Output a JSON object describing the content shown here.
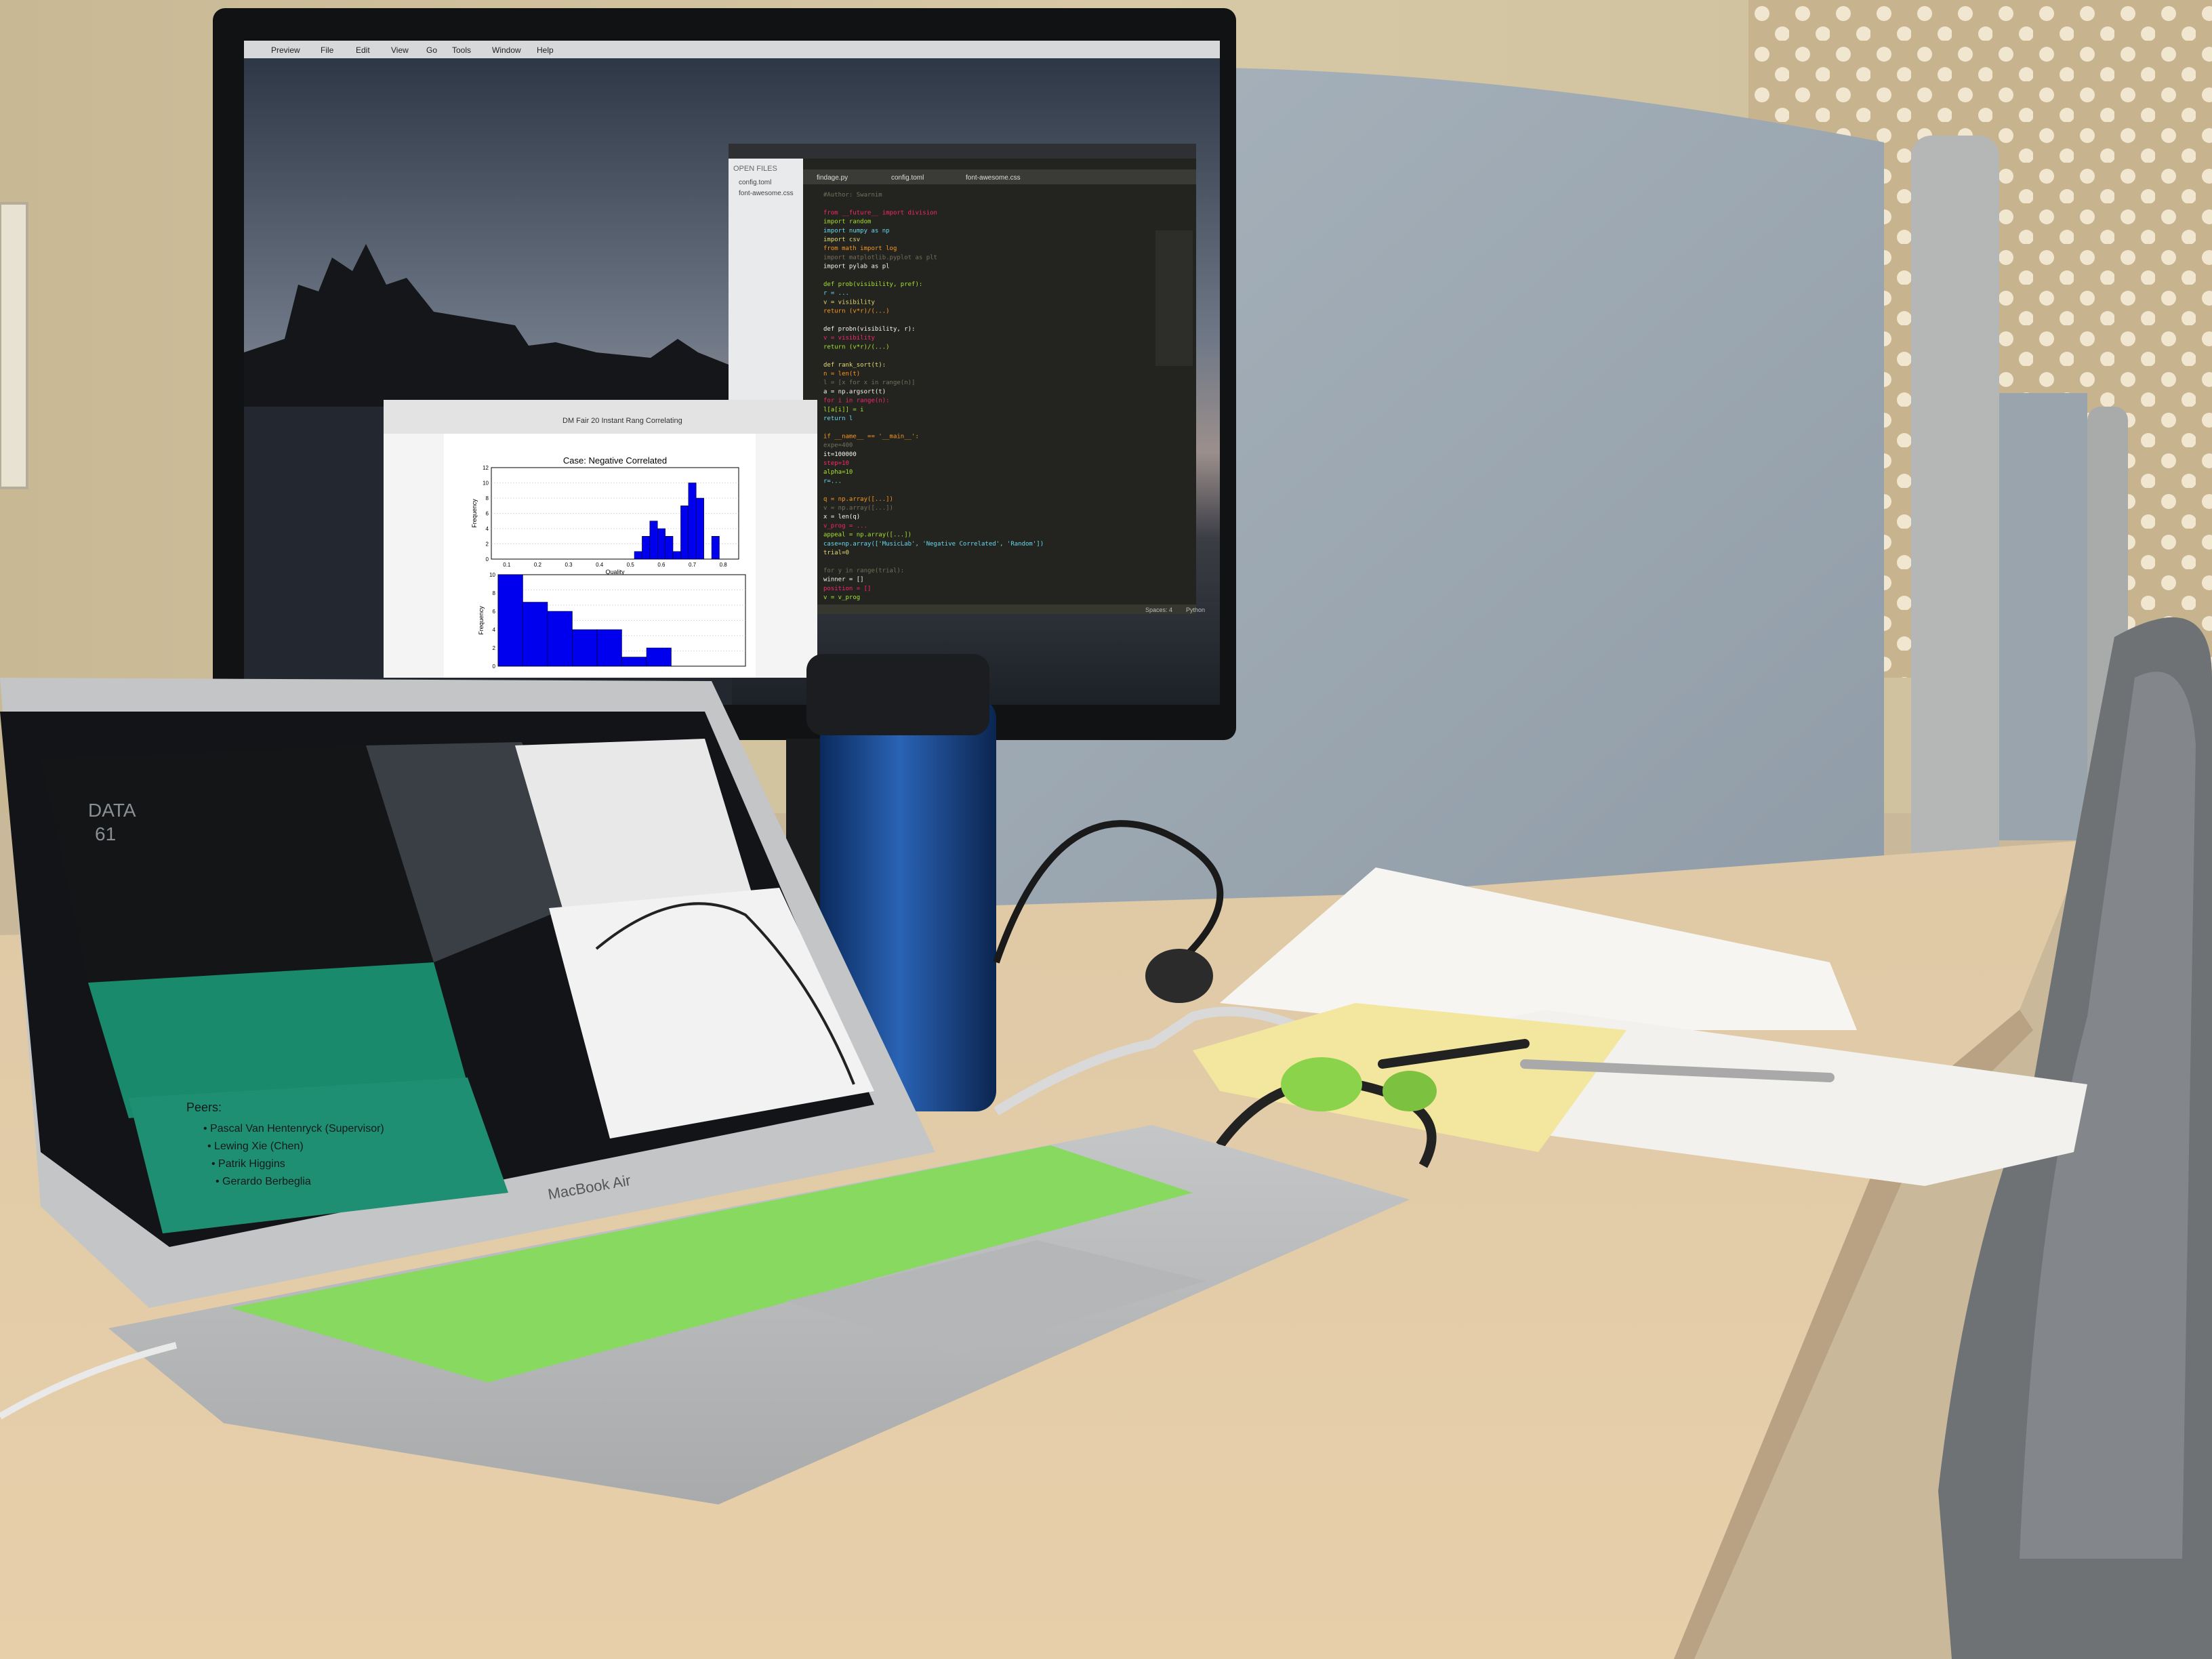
{
  "monitor": {
    "menubar": [
      "Preview",
      "File",
      "Edit",
      "View",
      "Go",
      "Tools",
      "Window",
      "Help"
    ],
    "sidebar": {
      "header": "OPEN FILES",
      "files": [
        "config.toml",
        "font-awesome.css"
      ]
    },
    "editor_tabs": [
      "findage.py",
      "config.toml",
      "font-awesome.css"
    ],
    "code_lines": [
      "#Author: Swarnim",
      "",
      "from __future__ import division",
      "import random",
      "import numpy as np",
      "import csv",
      "from math import log",
      "import matplotlib.pyplot as plt",
      "import pylab as pl",
      "",
      "def prob(visibility, pref):",
      "    r = ...",
      "    v = visibility",
      "    return (v*r)/(...)",
      "",
      "def probn(visibility, r):",
      "    v = visibility",
      "    return (v*r)/(...)",
      "",
      "def rank_sort(t):",
      "    n = len(t)",
      "    l = [x for x in range(n)]",
      "    a = np.argsort(t)",
      "    for i in range(n):",
      "        l[a[i]] = i",
      "    return l",
      "",
      "if __name__ == '__main__':",
      "    expe=400",
      "    it=100000",
      "    step=10",
      "    alpha=10",
      "    r=...",
      "",
      "    q = np.array([...])",
      "    v = np.array([...])",
      "    x = len(q)",
      "    v_prog = ...",
      "    appeal = np.array([...])",
      "    case=np.array(['MusicLab', 'Negative Correlated', 'Random'])",
      "    trial=0",
      "",
      "    for y in range(trial):",
      "        winner = []",
      "        position = []",
      "        v = v_prog"
    ],
    "status_bar": [
      "Spaces: 4",
      "Python"
    ],
    "preview_window_title": "DM Fair 20 Instant Rang Correlating"
  },
  "laptop": {
    "brand_text": "MacBook Air",
    "slide": {
      "badge_line1": "DATA",
      "badge_line2": "61",
      "heading": "Peers:",
      "bullets": [
        "Pascal Van Hentenryck (Supervisor)",
        "Lewing Xie (Chen)",
        "Patrik Higgins",
        "Gerardo Berbeglia"
      ]
    }
  },
  "chart_data": [
    {
      "type": "bar",
      "title": "Case: Negative Correlated",
      "xlabel": "Quality",
      "ylabel": "Frequency",
      "xlim": [
        0.05,
        0.85
      ],
      "ylim": [
        0,
        12
      ],
      "x_ticks": [
        "0.1",
        "0.2",
        "0.3",
        "0.4",
        "0.5",
        "0.6",
        "0.7",
        "0.8"
      ],
      "y_ticks": [
        "0",
        "2",
        "4",
        "6",
        "8",
        "10",
        "12"
      ],
      "bins": [
        {
          "x": 0.525,
          "value": 1
        },
        {
          "x": 0.55,
          "value": 3
        },
        {
          "x": 0.575,
          "value": 5
        },
        {
          "x": 0.6,
          "value": 4
        },
        {
          "x": 0.625,
          "value": 3
        },
        {
          "x": 0.65,
          "value": 1
        },
        {
          "x": 0.675,
          "value": 7
        },
        {
          "x": 0.7,
          "value": 10
        },
        {
          "x": 0.725,
          "value": 8
        },
        {
          "x": 0.75,
          "value": 0
        },
        {
          "x": 0.775,
          "value": 3
        }
      ],
      "bar_color": "#0000ee",
      "grid": true
    },
    {
      "type": "bar",
      "xlabel": "",
      "ylabel": "Frequency",
      "xlim": [
        0,
        50
      ],
      "ylim": [
        0,
        10
      ],
      "y_ticks": [
        "0",
        "2",
        "4",
        "6",
        "8",
        "10"
      ],
      "bins": [
        {
          "x": 2.5,
          "value": 10
        },
        {
          "x": 7.5,
          "value": 7
        },
        {
          "x": 12.5,
          "value": 6
        },
        {
          "x": 17.5,
          "value": 4
        },
        {
          "x": 22.5,
          "value": 4
        },
        {
          "x": 27.5,
          "value": 1
        },
        {
          "x": 32.5,
          "value": 2
        },
        {
          "x": 37.5,
          "value": 0
        },
        {
          "x": 42.5,
          "value": 0
        },
        {
          "x": 47.5,
          "value": 0
        }
      ],
      "bar_color": "#0000ee",
      "grid": true
    }
  ]
}
